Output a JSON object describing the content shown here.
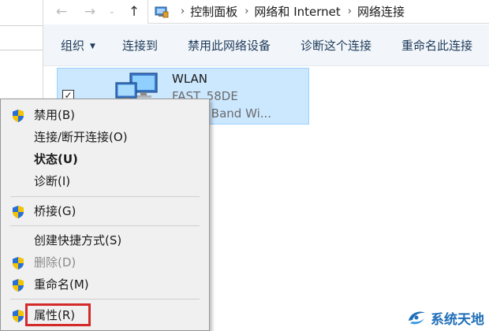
{
  "address_bar": {
    "breadcrumbs": [
      "控制面板",
      "网络和 Internet",
      "网络连接"
    ],
    "back_icon": "back-arrow-icon",
    "forward_icon": "forward-arrow-icon",
    "recent_icon": "chevron-down-icon",
    "up_icon": "up-arrow-icon"
  },
  "toolbar": {
    "items": [
      {
        "label": "组织",
        "has_dropdown": true
      },
      {
        "label": "连接到"
      },
      {
        "label": "禁用此网络设备"
      },
      {
        "label": "诊断这个连接"
      },
      {
        "label": "重命名此连接"
      }
    ]
  },
  "connection": {
    "name": "WLAN",
    "ssid": "FAST_58DE",
    "device": ") Dual Band Wi...",
    "checked": true,
    "checkmark": "✓"
  },
  "context_menu": {
    "items": [
      {
        "label": "禁用(B)",
        "shield": true,
        "bold": false,
        "disabled": false
      },
      {
        "label": "连接/断开连接(O)",
        "shield": false,
        "bold": false,
        "disabled": false
      },
      {
        "label": "状态(U)",
        "shield": false,
        "bold": true,
        "disabled": false
      },
      {
        "label": "诊断(I)",
        "shield": false,
        "bold": false,
        "disabled": false
      },
      {
        "label": "桥接(G)",
        "shield": true,
        "bold": false,
        "disabled": false
      },
      {
        "label": "创建快捷方式(S)",
        "shield": false,
        "bold": false,
        "disabled": false
      },
      {
        "label": "删除(D)",
        "shield": true,
        "bold": false,
        "disabled": true
      },
      {
        "label": "重命名(M)",
        "shield": true,
        "bold": false,
        "disabled": false
      },
      {
        "label": "属性(R)",
        "shield": true,
        "bold": false,
        "disabled": false,
        "highlighted": true
      }
    ]
  },
  "watermark": {
    "text": "系统天地"
  },
  "colors": {
    "highlight_border": "#d42a2a",
    "selection_fill": "#cce8ff",
    "toolbar_bg": "#f2f6fa",
    "menu_bg": "#f0f0f0"
  }
}
